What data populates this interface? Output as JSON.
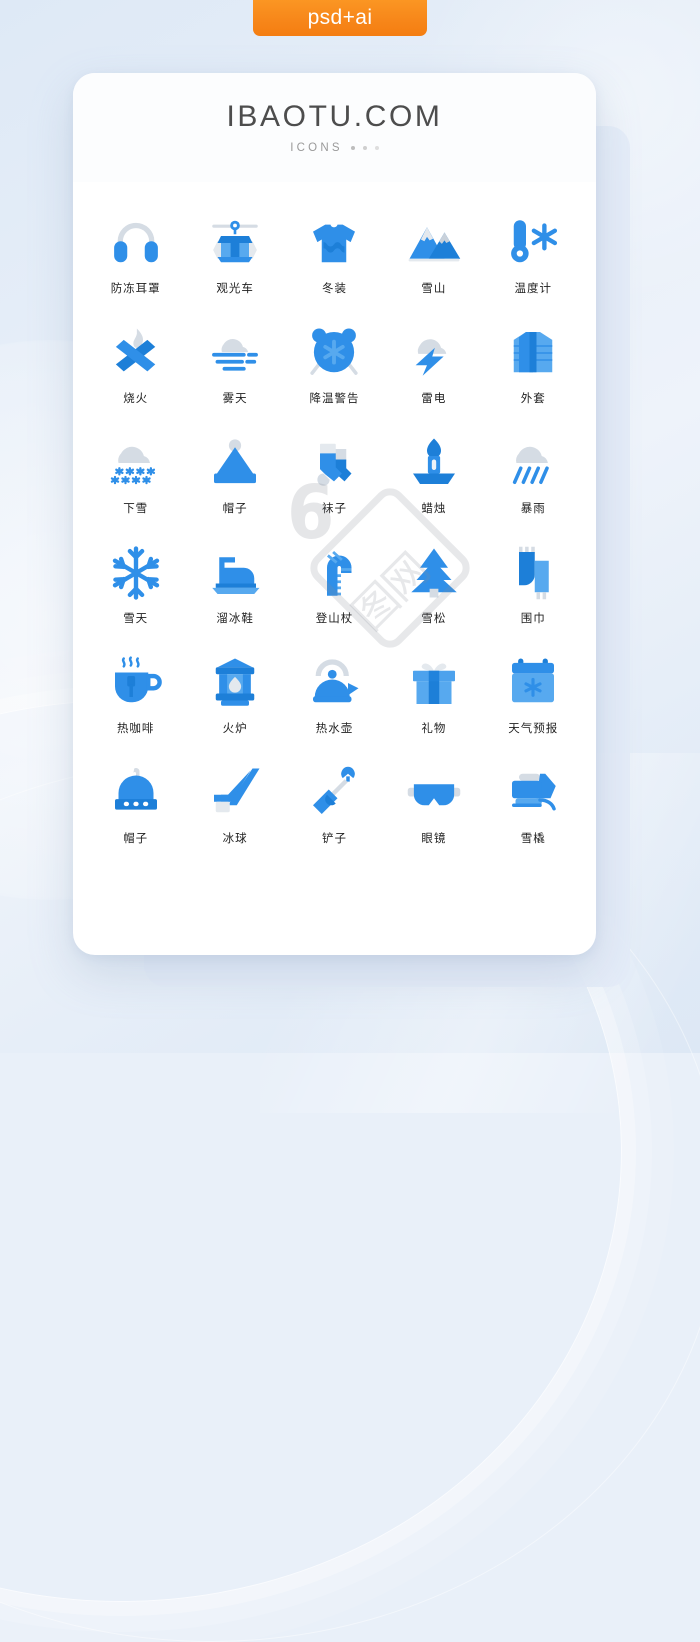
{
  "badge": {
    "label": "psd+ai"
  },
  "header": {
    "title": "IBAOTU.COM",
    "subtitle": "ICONS"
  },
  "watermark": {
    "logo_glyph": "6",
    "stamp_text": "图网"
  },
  "colors": {
    "accent_blue": "#2f8fe8",
    "accent_blue_dark": "#1d7fd8",
    "accent_blue_light": "#57a9ef",
    "neutral_gray": "#d5dce4",
    "neutral_gray_light": "#e4e9ee",
    "badge_orange": "#f7871a",
    "label_text": "#1f1f1f",
    "title_text": "#4d4d4d",
    "subtitle_text": "#9a9a9a",
    "card_bg": "#ffffff",
    "page_bg": "#e6eef8"
  },
  "icons": [
    {
      "label": "防冻耳罩",
      "name": "earmuffs-icon"
    },
    {
      "label": "观光车",
      "name": "cable-car-icon"
    },
    {
      "label": "冬装",
      "name": "winter-sweater-icon"
    },
    {
      "label": "雪山",
      "name": "snow-mountain-icon"
    },
    {
      "label": "温度计",
      "name": "thermometer-icon"
    },
    {
      "label": "烧火",
      "name": "campfire-icon"
    },
    {
      "label": "雾天",
      "name": "foggy-weather-icon"
    },
    {
      "label": "降温警告",
      "name": "cold-alarm-icon"
    },
    {
      "label": "雷电",
      "name": "thunderstorm-icon"
    },
    {
      "label": "外套",
      "name": "down-jacket-icon"
    },
    {
      "label": "下雪",
      "name": "snowing-cloud-icon"
    },
    {
      "label": "帽子",
      "name": "santa-hat-icon"
    },
    {
      "label": "袜子",
      "name": "socks-icon"
    },
    {
      "label": "蜡烛",
      "name": "candle-icon"
    },
    {
      "label": "暴雨",
      "name": "heavy-rain-icon"
    },
    {
      "label": "雪天",
      "name": "snowflake-icon"
    },
    {
      "label": "溜冰鞋",
      "name": "ice-skate-icon"
    },
    {
      "label": "登山杖",
      "name": "candy-cane-icon"
    },
    {
      "label": "雪松",
      "name": "pine-tree-icon"
    },
    {
      "label": "围巾",
      "name": "scarf-icon"
    },
    {
      "label": "热咖啡",
      "name": "hot-coffee-icon"
    },
    {
      "label": "火炉",
      "name": "stove-lantern-icon"
    },
    {
      "label": "热水壶",
      "name": "kettle-icon"
    },
    {
      "label": "礼物",
      "name": "gift-box-icon"
    },
    {
      "label": "天气预报",
      "name": "weather-forecast-icon"
    },
    {
      "label": "帽子",
      "name": "beanie-hat-icon"
    },
    {
      "label": "冰球",
      "name": "hockey-stick-icon"
    },
    {
      "label": "铲子",
      "name": "snow-shovel-icon"
    },
    {
      "label": "眼镜",
      "name": "ski-goggles-icon"
    },
    {
      "label": "雪橇",
      "name": "snowmobile-icon"
    }
  ]
}
